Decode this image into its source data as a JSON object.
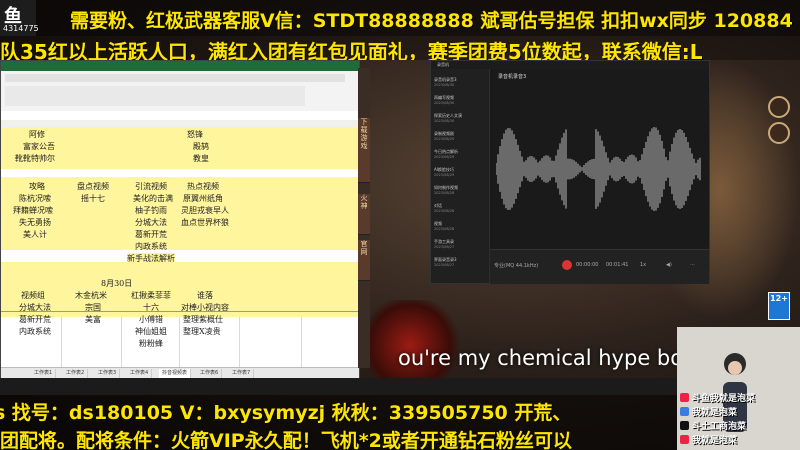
{
  "stream": {
    "logo": "鱼",
    "room_id": "4314775",
    "banner_top": "需要粉、红极武器客服V信：STDT88888888   斌哥估号担保 扣扣wx同步 120884",
    "banner_second": "队35红以上活跃人口，满红入团有红包见面礼，赛季团费5位数起，联系微信:L",
    "banner_bottom1": "s 找号：ds180105   V：bxysymyzj   秋秋：339505750  开荒、",
    "banner_bottom2": "团配将。配将条件：火箭VIP永久配！飞机*2或者开通钻石粉丝可以",
    "subtitle": "ou're my chemical hype bo",
    "age_badge": "12+"
  },
  "excel": {
    "title": "",
    "rows_top": [
      {
        "col_b": "阿修",
        "col_f": "怒锋"
      },
      {
        "col_b": "富家公吾",
        "col_f": "殿鸫"
      },
      {
        "col_b": "靴靴特帅尔",
        "col_f": "教皇"
      }
    ],
    "section1_headers": [
      "攻略",
      "盘点视频",
      "引流视频",
      "热点视频"
    ],
    "section1_rows": [
      [
        "陈杭况嗦",
        "摇十七",
        "美化的击满",
        "原翼州纸角"
      ],
      [
        "拜籍蝉况嗦",
        "",
        "柚子钓雨",
        "灵胆戎衰早人"
      ],
      [
        "失无勇扬",
        "",
        "分城大法",
        "血点世界杯狼"
      ],
      [
        "美人计",
        "",
        "葛新开荒",
        ""
      ],
      [
        "",
        "",
        "内政系统",
        ""
      ],
      [
        "",
        "",
        "新手战法解析",
        ""
      ]
    ],
    "date_header": "8月30日",
    "section2_headers": [
      "视频组",
      "木金杭米",
      "杠揪柔菲菲",
      "谁落"
    ],
    "section2_rows": [
      [
        "分城大法",
        "宗国",
        "十六",
        "对棒小视内容"
      ],
      [
        "葛新开荒",
        "美富",
        "小傅错",
        "整理紫概仕"
      ],
      [
        "内政系统",
        "",
        "神仙姐姐",
        "整理X凌贵"
      ],
      [
        "",
        "",
        "粉粉蜂",
        ""
      ]
    ],
    "sheet_tabs": [
      "工作表1",
      "工作表2",
      "工作表3",
      "工作表4",
      "抖音视频表",
      "工作表6",
      "工作表7"
    ]
  },
  "side_strip": {
    "buttons": [
      "下载游戏",
      "火神",
      "官网"
    ]
  },
  "recorder": {
    "app_title": "录音机",
    "main_title": "录音机录音3",
    "list": [
      {
        "name": "录音机录音3",
        "date": "2023/08/30"
      },
      {
        "name": "再编写视频",
        "date": "2023/08/30"
      },
      {
        "name": "探索历史人文演",
        "date": "2023/08/30"
      },
      {
        "name": "录制视频剧",
        "date": "2023/08/29"
      },
      {
        "name": "今日热点解析",
        "date": "2023/08/29"
      },
      {
        "name": "AI换脸技巧",
        "date": "2023/08/29"
      },
      {
        "name": "如何制作视频",
        "date": "2023/08/28"
      },
      {
        "name": "对话",
        "date": "2023/08/28"
      },
      {
        "name": "视频",
        "date": "2023/08/28"
      },
      {
        "name": "手游工具录",
        "date": "2023/08/27"
      },
      {
        "name": "界面录音录3",
        "date": "2023/08/27"
      }
    ],
    "time_current": "00:00:00",
    "time_total": "00:01:41",
    "speed": "1x",
    "footer_label": "专业(MQ 44.1kHz)"
  },
  "webcam": {
    "labels": [
      "斗鱼我就是泡菜",
      "我就是泡菜",
      "斗土工商泡菜",
      "我就是泡菜"
    ]
  },
  "colors": {
    "banner_text": "#ffe600",
    "excel_yellow": "#fff59d",
    "recorder_bg": "#1c1c1c",
    "record_red": "#dd3333"
  }
}
